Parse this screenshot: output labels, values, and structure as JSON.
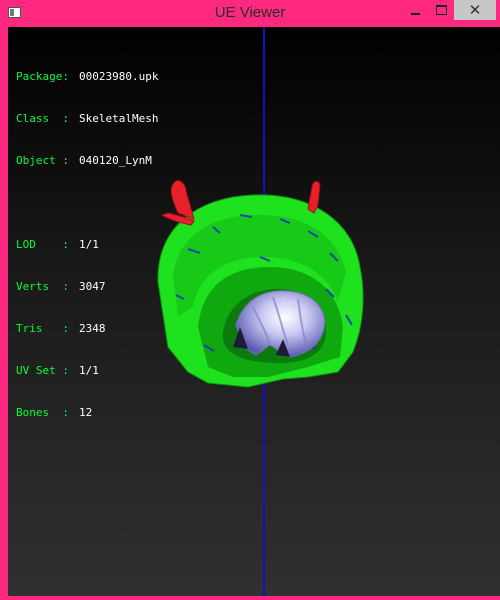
{
  "window": {
    "title": "UE Viewer",
    "minimize_symbol": "",
    "maximize_symbol": "",
    "close_symbol": "✕",
    "frame_color": "#ff2a7f",
    "icons": [
      "app-icon",
      "minimize-icon",
      "maximize-icon",
      "close-icon"
    ]
  },
  "info": {
    "group1": [
      {
        "label": "Package:",
        "value": "00023980.upk"
      },
      {
        "label": "Class  :",
        "value": "SkeletalMesh"
      },
      {
        "label": "Object :",
        "value": "040120_LynM"
      }
    ],
    "group2": [
      {
        "label": "LOD    :",
        "value": "1/1"
      },
      {
        "label": "Verts  :",
        "value": "3047"
      },
      {
        "label": "Tris   :",
        "value": "2348"
      },
      {
        "label": "UV Set :",
        "value": "1/1"
      },
      {
        "label": "Bones  :",
        "value": "12"
      }
    ]
  },
  "colors": {
    "label": "#00ff33",
    "value": "#ffffff",
    "mesh": "#1ee61e",
    "horns": "#e8202c",
    "core": "#b8b8e8",
    "axis": "#1010cc"
  }
}
